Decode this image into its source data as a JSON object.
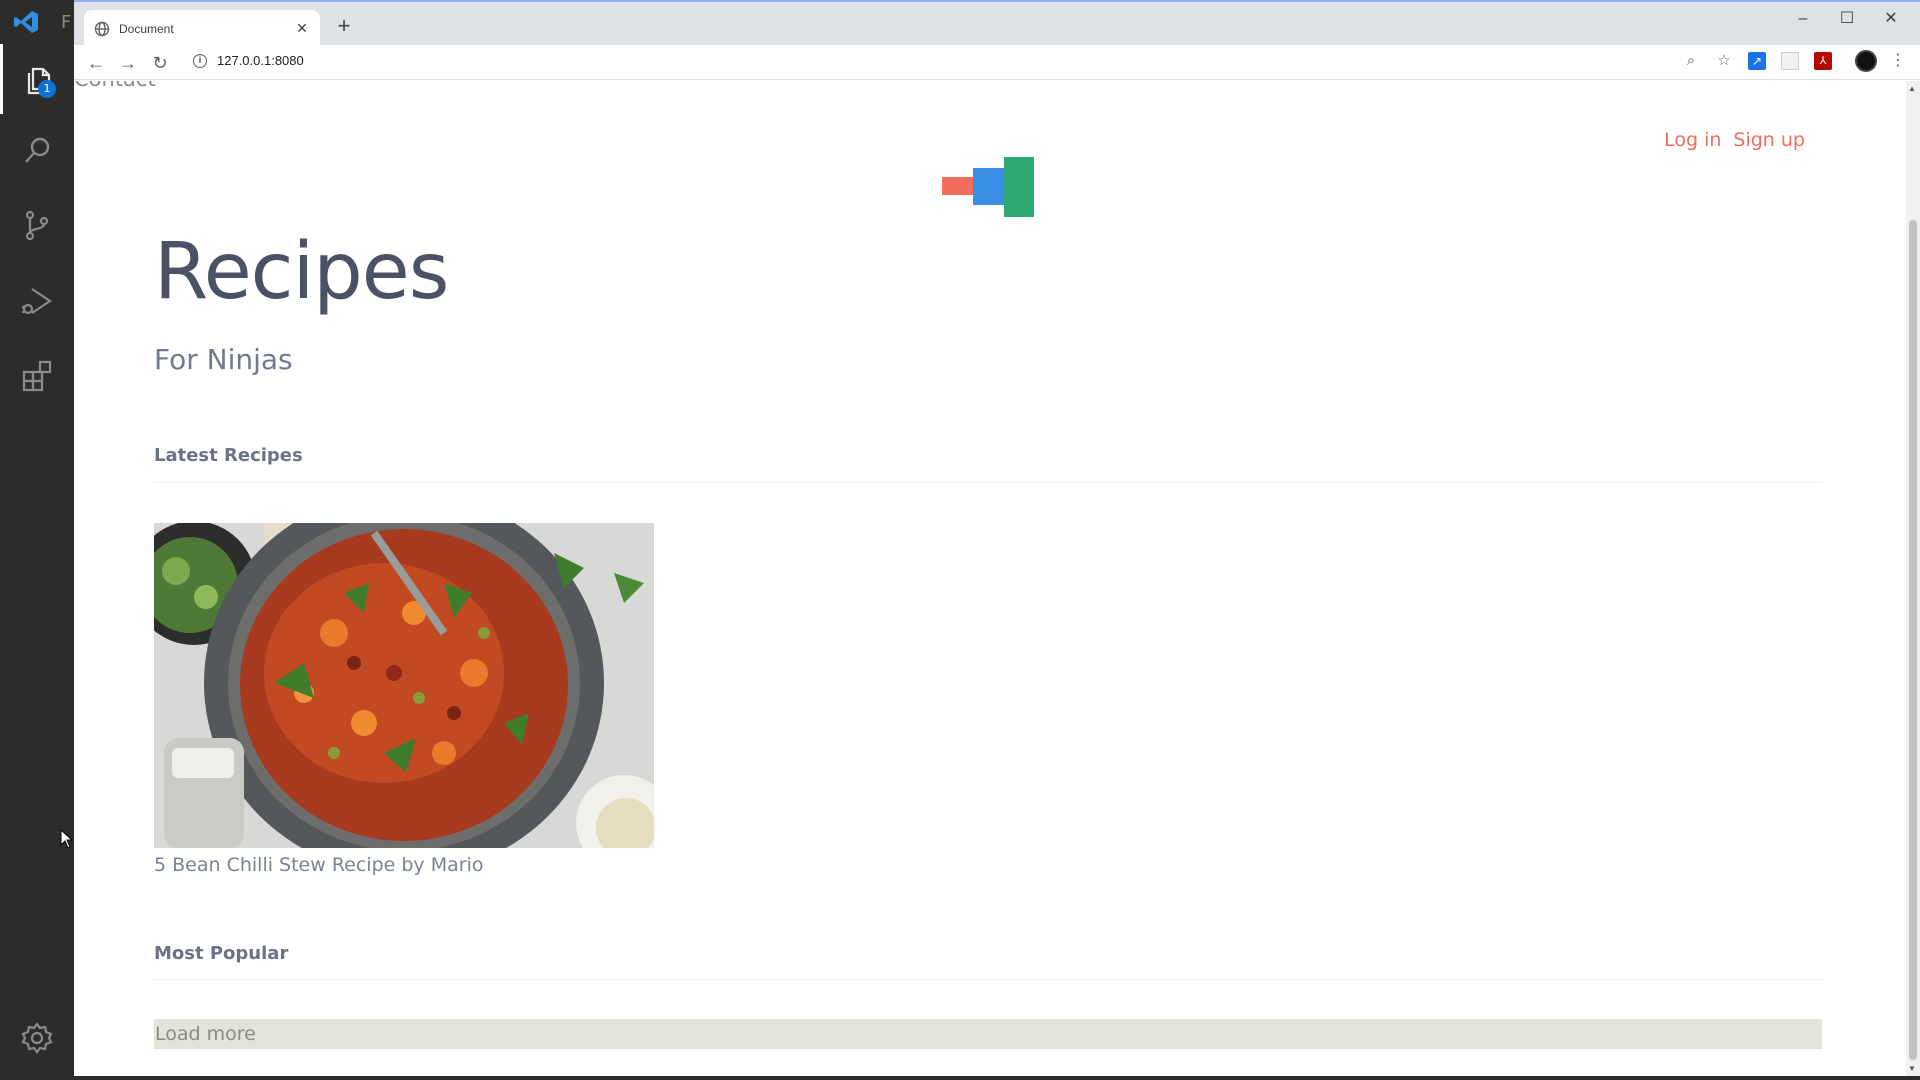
{
  "vscode": {
    "menu_letter": "F",
    "explorer_badge": "1",
    "icons": [
      "vscode-logo-icon",
      "files-icon",
      "search-icon",
      "source-control-icon",
      "run-debug-icon",
      "extensions-icon",
      "gear-icon"
    ]
  },
  "browser": {
    "tab_title": "Document",
    "tab_close": "✕",
    "new_tab": "+",
    "window": {
      "minimize": "–",
      "maximize": "☐",
      "close": "✕"
    },
    "address": "127.0.0.1:8080",
    "nav": {
      "back": "←",
      "forward": "→",
      "reload": "↻"
    }
  },
  "page": {
    "nav_contact": "Contact",
    "auth": {
      "login": "Log in",
      "signup": "Sign up"
    },
    "logo_colors": [
      "#f06e5b",
      "#3a8ee6",
      "#2fa874"
    ],
    "title": "Recipes",
    "subtitle": "For Ninjas",
    "latest_heading": "Latest Recipes",
    "recipes": [
      {
        "caption": "5 Bean Chilli Stew Recipe by Mario"
      }
    ],
    "popular_heading": "Most Popular",
    "load_more": "Load more"
  }
}
